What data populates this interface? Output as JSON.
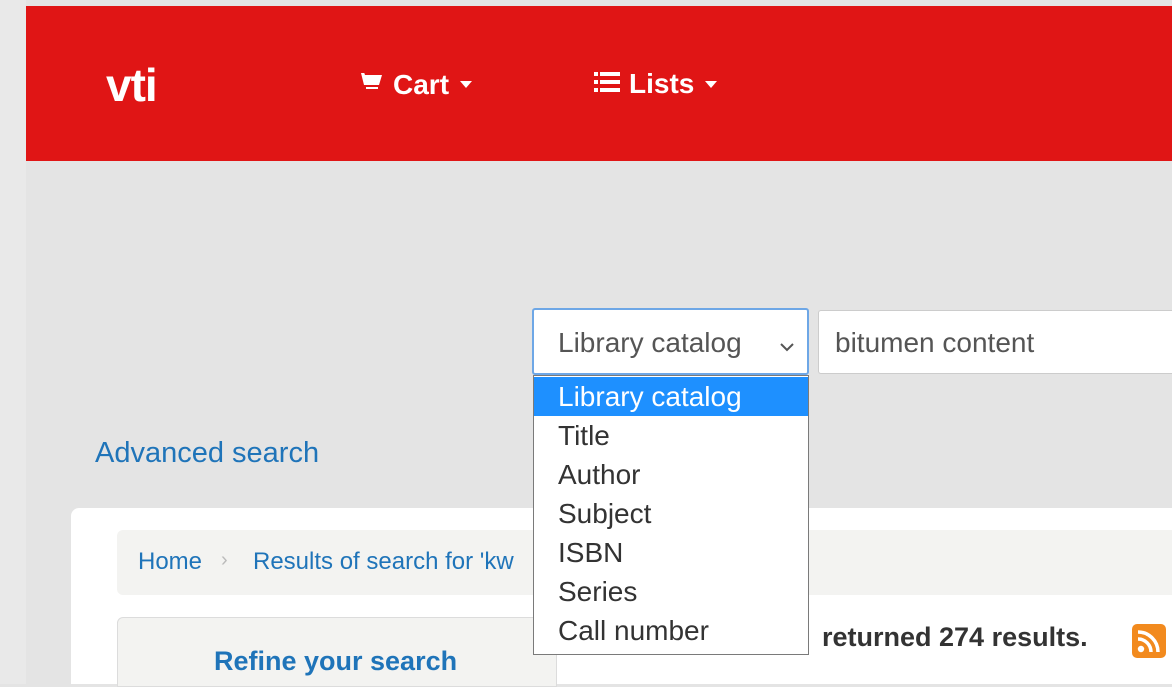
{
  "header": {
    "logo": "vti",
    "cart_label": "Cart",
    "lists_label": "Lists",
    "bg_color": "#e01515"
  },
  "search": {
    "selected_option": "Library catalog",
    "query_value": "bitumen content",
    "options": [
      "Library catalog",
      "Title",
      "Author",
      "Subject",
      "ISBN",
      "Series",
      "Call number"
    ]
  },
  "advanced_search_label": "Advanced search",
  "breadcrumb": {
    "home": "Home",
    "results": "Results of search for 'kw"
  },
  "sidebar": {
    "refine_title": "Refine your search"
  },
  "results_summary": "returned 274 results.",
  "icons": {
    "cart": "cart-icon",
    "lists": "list-icon",
    "rss": "rss-icon"
  },
  "colors": {
    "accent_red": "#e01515",
    "link_blue": "#1f74b9",
    "selected_option_bg": "#1e90ff"
  }
}
